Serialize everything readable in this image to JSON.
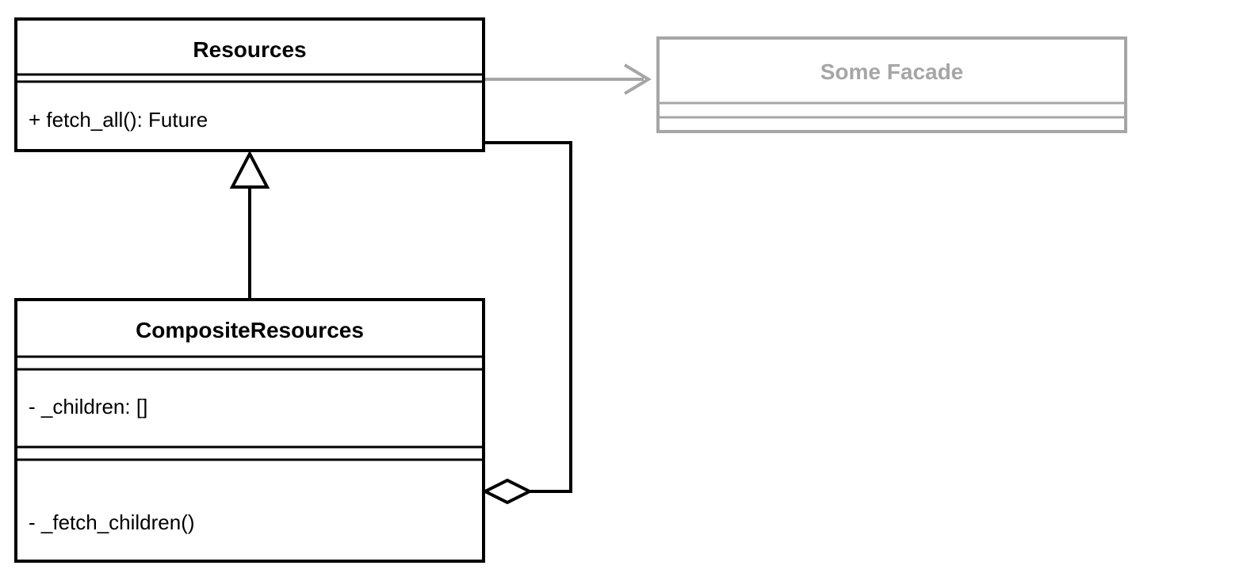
{
  "classes": {
    "resources": {
      "name": "Resources",
      "methods": [
        "+ fetch_all(): Future"
      ]
    },
    "compositeResources": {
      "name": "CompositeResources",
      "attributes": [
        "- _children: []"
      ],
      "methods": [
        "- _fetch_children()"
      ]
    },
    "someFacade": {
      "name": "Some Facade"
    }
  }
}
